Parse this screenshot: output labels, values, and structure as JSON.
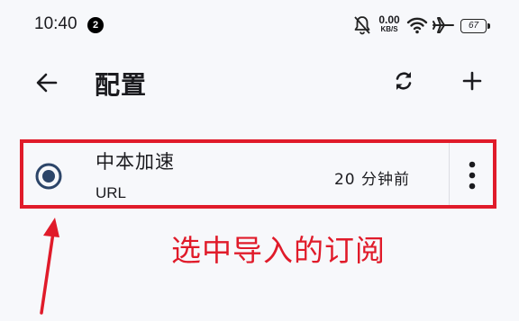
{
  "status_bar": {
    "time": "10:40",
    "notification_count": "2",
    "net_speed_value": "0.00",
    "net_speed_unit": "KB/S",
    "battery": "67"
  },
  "app_bar": {
    "title": "配置",
    "back_icon": "arrow-left-icon",
    "sync_icon": "sync-icon",
    "add_icon": "plus-icon"
  },
  "profiles": [
    {
      "name": "中本加速",
      "type": "URL",
      "updated": "20 分钟前",
      "selected": true
    }
  ],
  "annotation": {
    "text": "选中导入的订阅",
    "color": "#e01b2a"
  },
  "colors": {
    "accent": "#2c4569",
    "highlight": "#e01b2a"
  }
}
